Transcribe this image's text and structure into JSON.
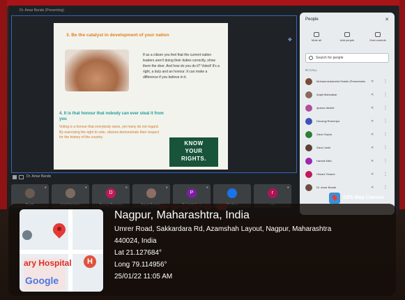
{
  "meeting": {
    "title": "Dr. Amar Bande (Presenting)",
    "presenter_label": "Dr. Amar Bande",
    "slide": {
      "heading1": "3. Be the catalyst in development of your nation",
      "para1": "If as a citizen you feel that the current nation leaders aren't doing their duties correctly, show them the door. And how do you do it? Voted! It's a right, a duty and an honour. It can make a difference if you believe in it.",
      "heading2": "4. It is that honour that nobody can ever steal it from you",
      "para2": "Voting is a honour that everybody owes, yet many do not regard. By exercising the right to vote, citizens demonstrate their respect for the history of the country.",
      "sign_line1": "KNOW",
      "sign_line2": "YOUR",
      "sign_line3": "RIGHTS."
    }
  },
  "people_panel": {
    "title": "People",
    "close": "✕",
    "actions": [
      "Mute all",
      "Add people",
      "Host controls"
    ],
    "search_placeholder": "Search for people",
    "in_call_label": "IN CALL",
    "participants": [
      {
        "name": "Mohammedshahid Shaikh (Presentation)",
        "color": "#7a4b3a"
      },
      {
        "name": "Anjali Mahulakar",
        "color": "#8a6a5a"
      },
      {
        "name": "aparna dhoble",
        "color": "#b34e9b"
      },
      {
        "name": "Devangi Rumeriya",
        "color": "#3f51b5"
      },
      {
        "name": "Gauri Gupta",
        "color": "#2e7d32"
      },
      {
        "name": "Gauri Joshi",
        "color": "#5d4037"
      },
      {
        "name": "Harshit Nitin",
        "color": "#9c27b0"
      },
      {
        "name": "Himani Yesane",
        "color": "#c2185b"
      },
      {
        "name": "Dr. Amar Bande",
        "color": "#6d4c41"
      }
    ]
  },
  "tiles": [
    {
      "name": "Shabib",
      "initial": "",
      "color": "#6b5a50"
    },
    {
      "name": "Anjali Mahulakar",
      "initial": "",
      "color": "#7d6b60"
    },
    {
      "name": "Devangi Rumeriya",
      "initial": "D",
      "color": "#c2185b"
    },
    {
      "name": "Sakshi Ramteke",
      "initial": "",
      "color": "#8d6e63"
    },
    {
      "name": "Pallavi Kalbhor",
      "initial": "P",
      "color": "#7b1fa2"
    },
    {
      "name": "24 others",
      "initial": "",
      "color": "#1a73e8"
    },
    {
      "name": "sys",
      "initial": "r",
      "color": "#ad1457"
    }
  ],
  "gps": {
    "badge": "GPS Map Camera",
    "city": "Nagpur, Maharashtra, India",
    "address": "Umrer Road, Sakkardara Rd, Azamshah Layout, Nagpur, Maharashtra",
    "pincode": "440024, India",
    "lat": "Lat 21.127684°",
    "long": "Long 79.114956°",
    "datetime": "25/01/22 11:05 AM",
    "map_hospital_label": "ary Hospital",
    "map_h_icon": "H",
    "map_google": "Google"
  }
}
